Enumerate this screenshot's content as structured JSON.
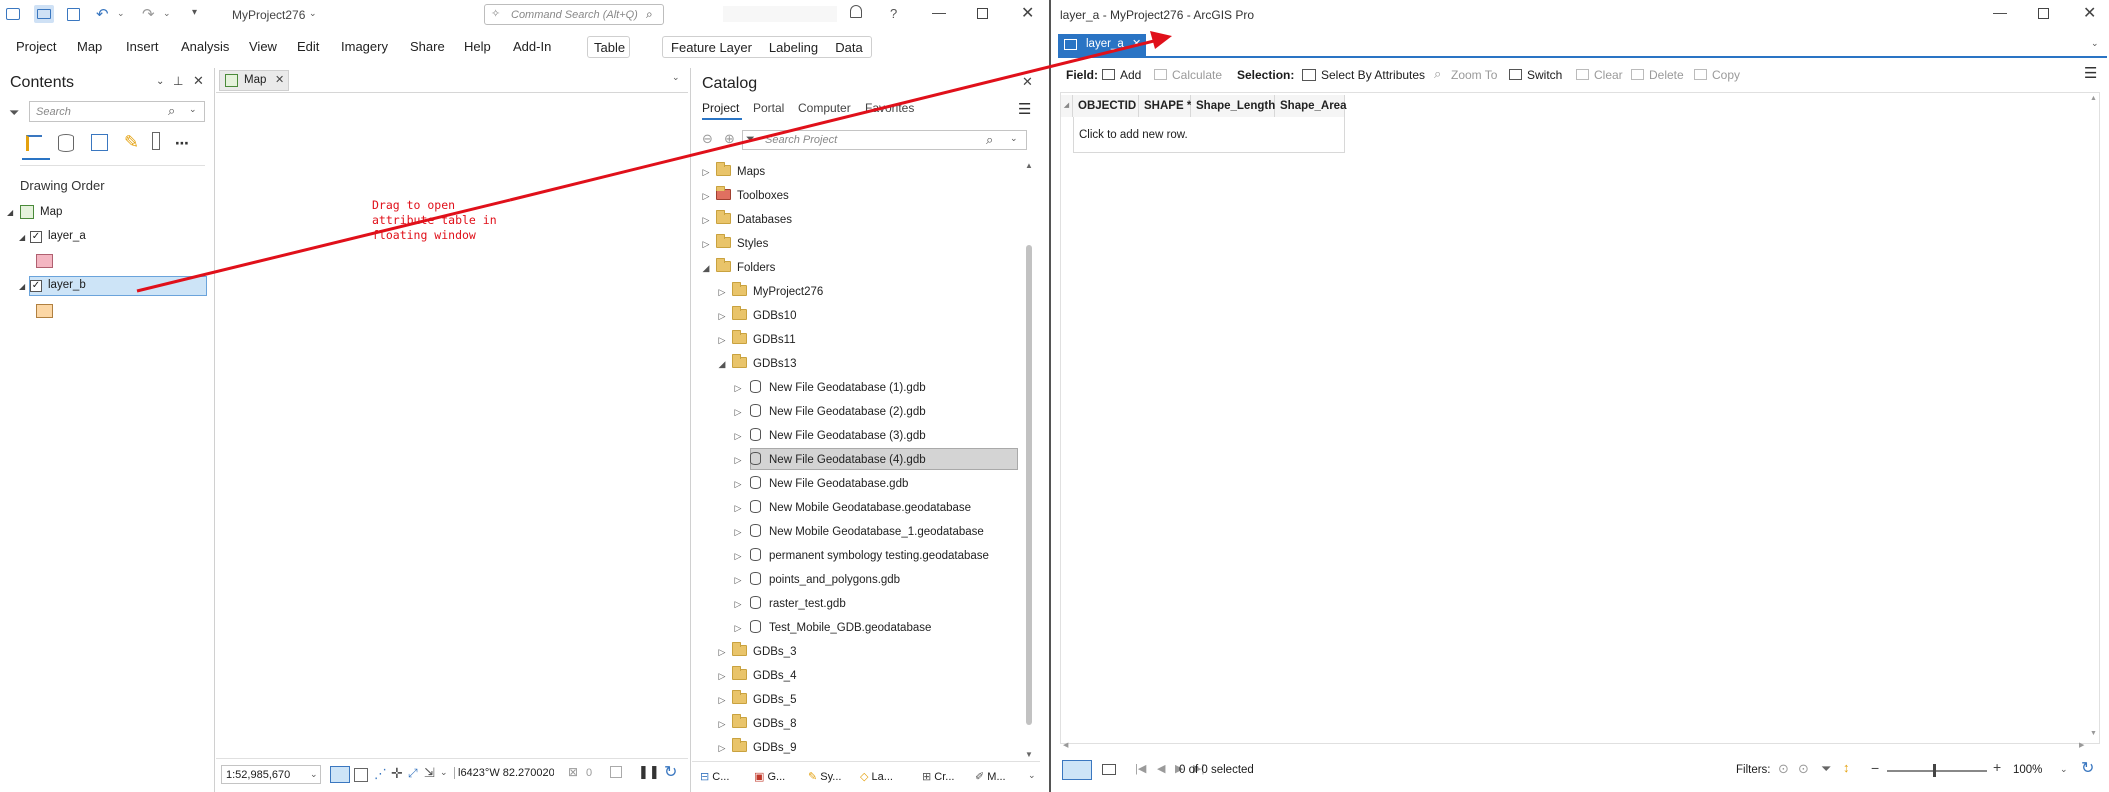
{
  "left_window": {
    "project_name": "MyProject276",
    "command_search_placeholder": "Command Search (Alt+Q)",
    "menu": [
      "Project",
      "Map",
      "Insert",
      "Analysis",
      "View",
      "Edit",
      "Imagery",
      "Share",
      "Help",
      "Add-In"
    ],
    "context_tabs": [
      "Table",
      "Feature Layer",
      "Labeling",
      "Data"
    ],
    "contents": {
      "title": "Contents",
      "search_placeholder": "Search",
      "drawing_order_label": "Drawing Order",
      "map_label": "Map",
      "layers": [
        {
          "name": "layer_a",
          "swatch_color": "#f4b6c2",
          "swatch_border": "#b06070"
        },
        {
          "name": "layer_b",
          "swatch_color": "#fcd7a5",
          "swatch_border": "#b08040"
        }
      ]
    },
    "map_tab_label": "Map",
    "annotation_text": "Drag to open attribute table in floating window",
    "map_status": {
      "scale": "1:52,985,670",
      "coords": "l6423°W 82.270020'",
      "count": "0"
    },
    "catalog": {
      "title": "Catalog",
      "tabs": [
        "Project",
        "Portal",
        "Computer",
        "Favorites"
      ],
      "search_placeholder": "Search Project",
      "top_items": [
        "Maps",
        "Toolboxes",
        "Databases",
        "Styles",
        "Folders"
      ],
      "folder_children": [
        "MyProject276",
        "GDBs10",
        "GDBs11",
        "GDBs13"
      ],
      "gdbs13_children": [
        "New File Geodatabase (1).gdb",
        "New File Geodatabase (2).gdb",
        "New File Geodatabase (3).gdb",
        "New File Geodatabase (4).gdb",
        "New File Geodatabase.gdb",
        "New Mobile Geodatabase.geodatabase",
        "New Mobile Geodatabase_1.geodatabase",
        "permanent symbology testing.geodatabase",
        "points_and_polygons.gdb",
        "raster_test.gdb",
        "Test_Mobile_GDB.geodatabase"
      ],
      "more_folders": [
        "GDBs_3",
        "GDBs_4",
        "GDBs_5",
        "GDBs_8",
        "GDBs_9"
      ],
      "selected_item": "New File Geodatabase (4).gdb"
    },
    "bottom_tabs": [
      "C...",
      "G...",
      "Sy...",
      "La...",
      "Cr...",
      "M..."
    ]
  },
  "right_window": {
    "title": "layer_a - MyProject276 - ArcGIS Pro",
    "tab_label": "layer_a",
    "toolbar": {
      "field_label": "Field:",
      "add_label": "Add",
      "calculate_label": "Calculate",
      "selection_label": "Selection:",
      "select_by_attributes_label": "Select By Attributes",
      "zoom_to_label": "Zoom To",
      "switch_label": "Switch",
      "clear_label": "Clear",
      "delete_label": "Delete",
      "copy_label": "Copy"
    },
    "columns": [
      "OBJECTID *",
      "SHAPE *",
      "Shape_Length",
      "Shape_Area"
    ],
    "add_row_text": "Click to add new row.",
    "status": {
      "selected_text": "0 of 0 selected",
      "filters_label": "Filters:",
      "zoom": "100%"
    }
  },
  "colors": {
    "accent": "#2a74c4",
    "arrow": "#e0101a",
    "selection_bg": "#cde4f7",
    "selected_tree_bg": "#d4d4d4"
  }
}
